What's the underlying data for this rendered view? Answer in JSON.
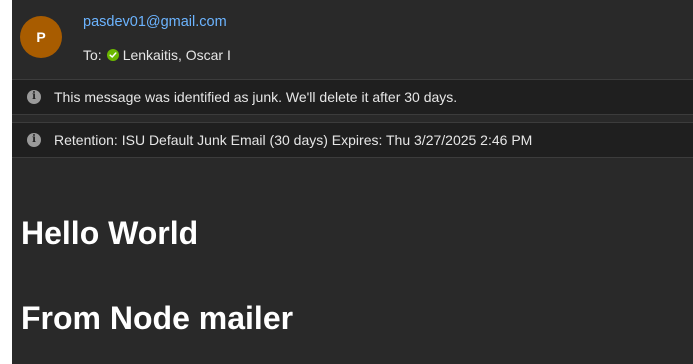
{
  "header": {
    "avatar_initial": "P",
    "sender_email": "pasdev01@gmail.com",
    "to_label": "To:",
    "recipient_name": "Lenkaitis, Oscar I"
  },
  "notices": [
    {
      "icon": "info-icon",
      "text": "This message was identified as junk. We'll delete it after 30 days."
    },
    {
      "icon": "info-icon",
      "text": "Retention: ISU Default Junk Email (30 days) Expires: Thu 3/27/2025 2:46 PM"
    }
  ],
  "message_body": {
    "heading_1": "Hello World",
    "heading_2": "From Node mailer"
  },
  "colors": {
    "background": "#292929",
    "notice_background": "#1f1f1f",
    "avatar": "#a85c00",
    "link": "#6cb4ff",
    "presence_available": "#6bb700"
  }
}
